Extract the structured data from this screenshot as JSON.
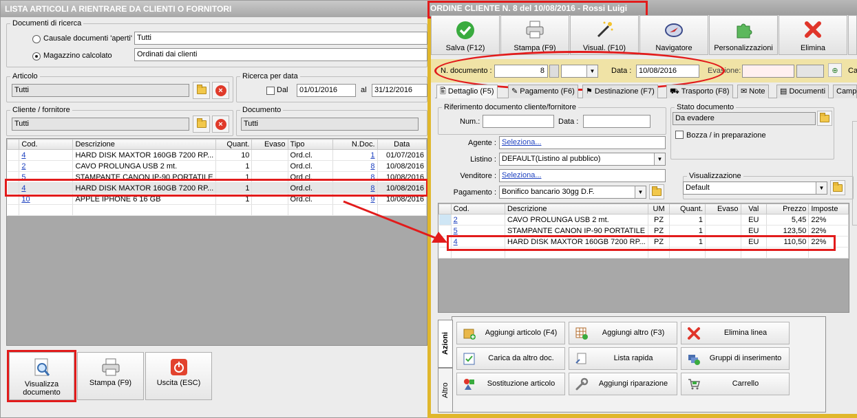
{
  "list_window": {
    "title": "LISTA ARTICOLI A RIENTRARE DA CLIENTI O FORNITORI",
    "search_group": "Documenti di ricerca",
    "radio_causale": "Causale documenti 'aperti'",
    "causale_value": "Tutti",
    "radio_magazzino": "Magazzino calcolato",
    "magazzino_value": "Ordinati dai clienti",
    "articolo_group": "Articolo",
    "articolo_value": "Tutti",
    "date_group": "Ricerca per data",
    "dal_label": "Dal",
    "date_from": "01/01/2016",
    "al_label": "al",
    "date_to": "31/12/2016",
    "cliente_group": "Cliente / fornitore",
    "cliente_value": "Tutti",
    "documento_group": "Documento",
    "documento_value": "Tutti",
    "columns": [
      "Cod.",
      "Descrizione",
      "Quant.",
      "Evaso",
      "Tipo",
      "N.Doc.",
      "Data"
    ],
    "rows": [
      {
        "cod": "4",
        "desc": "HARD DISK MAXTOR 160GB 7200 RP...",
        "qty": "10",
        "evaso": "",
        "tipo": "Ord.cl.",
        "ndoc": "1",
        "data": "01/07/2016"
      },
      {
        "cod": "2",
        "desc": "CAVO PROLUNGA USB 2 mt.",
        "qty": "1",
        "evaso": "",
        "tipo": "Ord.cl.",
        "ndoc": "8",
        "data": "10/08/2016"
      },
      {
        "cod": "5",
        "desc": "STAMPANTE CANON IP-90 PORTATILE",
        "qty": "1",
        "evaso": "",
        "tipo": "Ord.cl.",
        "ndoc": "8",
        "data": "10/08/2016"
      },
      {
        "cod": "4",
        "desc": "HARD DISK MAXTOR 160GB 7200 RP...",
        "qty": "1",
        "evaso": "",
        "tipo": "Ord.cl.",
        "ndoc": "8",
        "data": "10/08/2016"
      },
      {
        "cod": "10",
        "desc": "APPLE IPHONE 6 16 GB",
        "qty": "1",
        "evaso": "",
        "tipo": "Ord.cl.",
        "ndoc": "9",
        "data": "10/08/2016"
      }
    ],
    "btn_visualizza": "Visualizza documento",
    "btn_stampa": "Stampa (F9)",
    "btn_uscita": "Uscita (ESC)"
  },
  "order_window": {
    "title": "ORDINE CLIENTE N. 8 del 10/08/2016 - Rossi Luigi",
    "toolbar": [
      "Salva (F12)",
      "Stampa (F9)",
      "Visual. (F10)",
      "Navigatore",
      "Personalizzazioni",
      "Elimina"
    ],
    "ndoc_label": "N. documento :",
    "ndoc_value": "8",
    "data_label": "Data :",
    "data_value": "10/08/2016",
    "evasione_label": "Evasione:",
    "cut_label": "Ca",
    "tabs": [
      "Dettaglio (F5)",
      "Pagamento (F6)",
      "Destinazione (F7)",
      "Trasporto (F8)",
      "Note",
      "Documenti",
      "Campi"
    ],
    "rif_group": "Riferimento documento cliente/fornitore",
    "num_label": "Num.:",
    "data2_label": "Data :",
    "stato_group": "Stato documento",
    "stato_value": "Da evadere",
    "bozza_label": "Bozza / in preparazione",
    "agente_label": "Agente :",
    "agente_value": "Seleziona...",
    "listino_label": "Listino :",
    "listino_value": "DEFAULT(Listino al pubblico)",
    "venditore_label": "Venditore :",
    "venditore_value": "Seleziona...",
    "pagamento_label": "Pagamento :",
    "pagamento_value": "Bonifico bancario 30gg D.F.",
    "vis_group": "Visualizzazione",
    "vis_value": "Default",
    "columns": [
      "Cod.",
      "Descrizione",
      "UM",
      "Quant.",
      "Evaso",
      "Val",
      "Prezzo",
      "Imposte"
    ],
    "rows": [
      {
        "cod": "2",
        "desc": "CAVO PROLUNGA USB 2 mt.",
        "um": "PZ",
        "qty": "1",
        "evaso": "",
        "val": "EU",
        "prezzo": "5,45",
        "imposte": "22%"
      },
      {
        "cod": "5",
        "desc": "STAMPANTE CANON IP-90 PORTATILE",
        "um": "PZ",
        "qty": "1",
        "evaso": "",
        "val": "EU",
        "prezzo": "123,50",
        "imposte": "22%"
      },
      {
        "cod": "4",
        "desc": "HARD DISK MAXTOR 160GB 7200 RP...",
        "um": "PZ",
        "qty": "1",
        "evaso": "",
        "val": "EU",
        "prezzo": "110,50",
        "imposte": "22%"
      }
    ],
    "vtab_azioni": "Azioni",
    "vtab_altro": "Altro",
    "actions": [
      "Aggiungi articolo (F4)",
      "Aggiungi altro (F3)",
      "Elimina linea",
      "Carica da altro doc.",
      "Lista rapida",
      "Gruppi di inserimento",
      "Sostituzione articolo",
      "Aggiungi riparazione",
      "Carrello"
    ]
  },
  "colors": {
    "accent_red": "#e21b1b",
    "window_border": "#e0b72c",
    "link": "#1b3fbf"
  }
}
